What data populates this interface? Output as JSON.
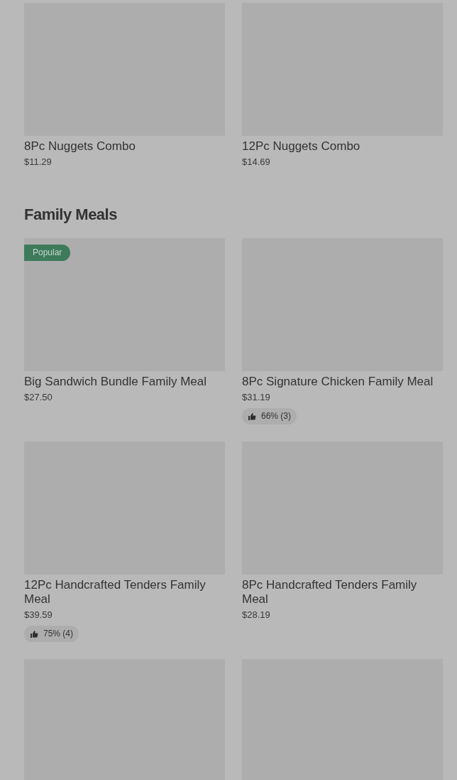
{
  "sections": [
    {
      "items": [
        {
          "kind": "product",
          "name": "8Pc Nuggets Combo",
          "price": "$11.29"
        },
        {
          "kind": "product",
          "name": "12Pc Nuggets Combo",
          "price": "$14.69"
        }
      ]
    },
    {
      "title": "Family Meals",
      "items": [
        {
          "kind": "product",
          "name": "Big Sandwich Bundle Family Meal",
          "price": "$27.50",
          "badge": "Popular"
        },
        {
          "kind": "product",
          "name": "8Pc Signature Chicken Family Meal",
          "price": "$31.19",
          "rating": "66% (3)"
        },
        {
          "kind": "product",
          "name": "12Pc Handcrafted Tenders Family Meal",
          "price": "$39.59",
          "rating": "75% (4)"
        },
        {
          "kind": "product",
          "name": "8Pc Handcrafted Tenders Family Meal",
          "price": "$28.19"
        },
        {
          "kind": "image_only"
        },
        {
          "kind": "image_only"
        }
      ]
    }
  ]
}
